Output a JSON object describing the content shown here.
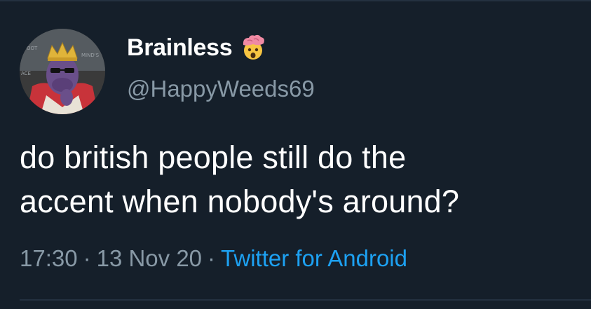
{
  "user": {
    "display_name": "Brainless",
    "handle": "@HappyWeeds69",
    "status_emoji": "exploding-head-emoji"
  },
  "tweet": {
    "text_line1": "do british people still do the",
    "text_line2": "accent when nobody's around?",
    "time": "17:30",
    "date": "13 Nov 20",
    "separator": "·",
    "source": "Twitter for Android"
  },
  "colors": {
    "background": "#151f2a",
    "text": "#ffffff",
    "muted": "#8899a6",
    "link": "#1da1f2",
    "divider": "#243140"
  }
}
